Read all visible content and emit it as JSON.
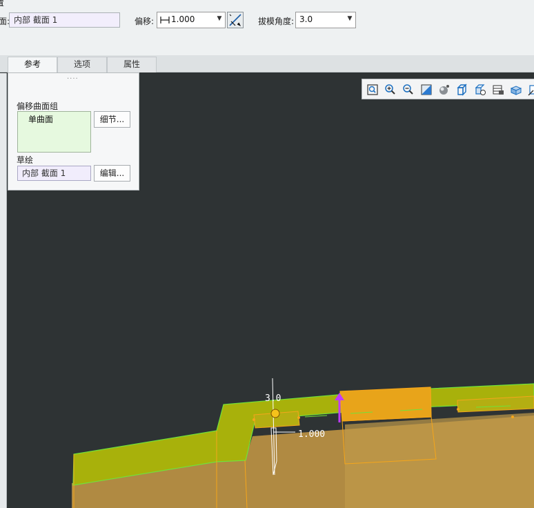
{
  "ribbon": {
    "title_fragment": "置",
    "section_label": "面:",
    "section_value": "内部 截面 1",
    "offset_label": "偏移:",
    "offset_value": "1.000",
    "draft_label": "拔模角度:",
    "draft_value": "3.0"
  },
  "tabs": [
    {
      "label": "参考"
    },
    {
      "label": "选项"
    },
    {
      "label": "属性"
    }
  ],
  "panel": {
    "grip": "....",
    "surface_set_label": "偏移曲面组",
    "surface_item": "单曲面",
    "details_button": "细节...",
    "sketch_label": "草绘",
    "sketch_value": "内部 截面 1",
    "edit_button": "编辑..."
  },
  "toolbar": {
    "icons": [
      "zoom-fit-icon",
      "zoom-in-icon",
      "zoom-out-icon",
      "repaint-icon",
      "appearance-icon",
      "display-style-icon",
      "saved-views-icon",
      "view-manager-icon",
      "perspective-icon",
      "annotation-icon"
    ]
  },
  "viewport": {
    "draft_dim_text": "3.0",
    "offset_dim_text": "1.000",
    "colors": {
      "background": "#2e3334",
      "preview_surface": "#a8b10b",
      "edge": "#6fe33b",
      "feature_highlight": "#f5a61b",
      "solid": "#b38a3c",
      "direction_arrow": "#c03cff"
    }
  }
}
